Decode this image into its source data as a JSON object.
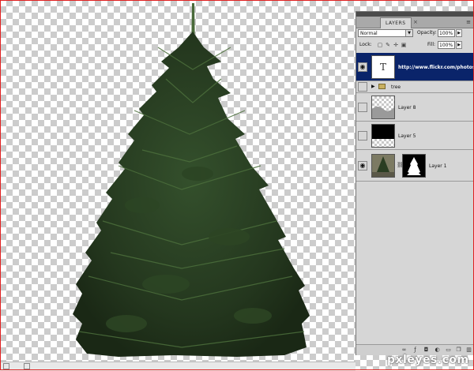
{
  "panel": {
    "tab_label": "LAYERS",
    "tab_close": "×",
    "menu_icon": "≡",
    "blend_mode": "Normal",
    "opacity_label": "Opacity:",
    "opacity_value": "100%",
    "lock_label": "Lock:",
    "fill_label": "Fill:",
    "fill_value": "100%"
  },
  "layers": [
    {
      "name": "http://www.flickr.com/photos",
      "type": "text",
      "thumb_letter": "T",
      "visible": true,
      "selected": true
    },
    {
      "name": "tree",
      "type": "group",
      "visible": false,
      "selected": false
    },
    {
      "name": "Layer 8",
      "type": "image",
      "visible": false,
      "selected": false
    },
    {
      "name": "Layer 5",
      "type": "image",
      "visible": false,
      "selected": false
    },
    {
      "name": "Layer 1",
      "type": "image-with-mask",
      "visible": true,
      "selected": false
    }
  ],
  "watermark": "pxleyes.com",
  "colors": {
    "selected_row": "#0a246a",
    "tree_dark": "#1f2e1a",
    "tree_mid": "#34502c",
    "frame_red": "#e02020"
  }
}
